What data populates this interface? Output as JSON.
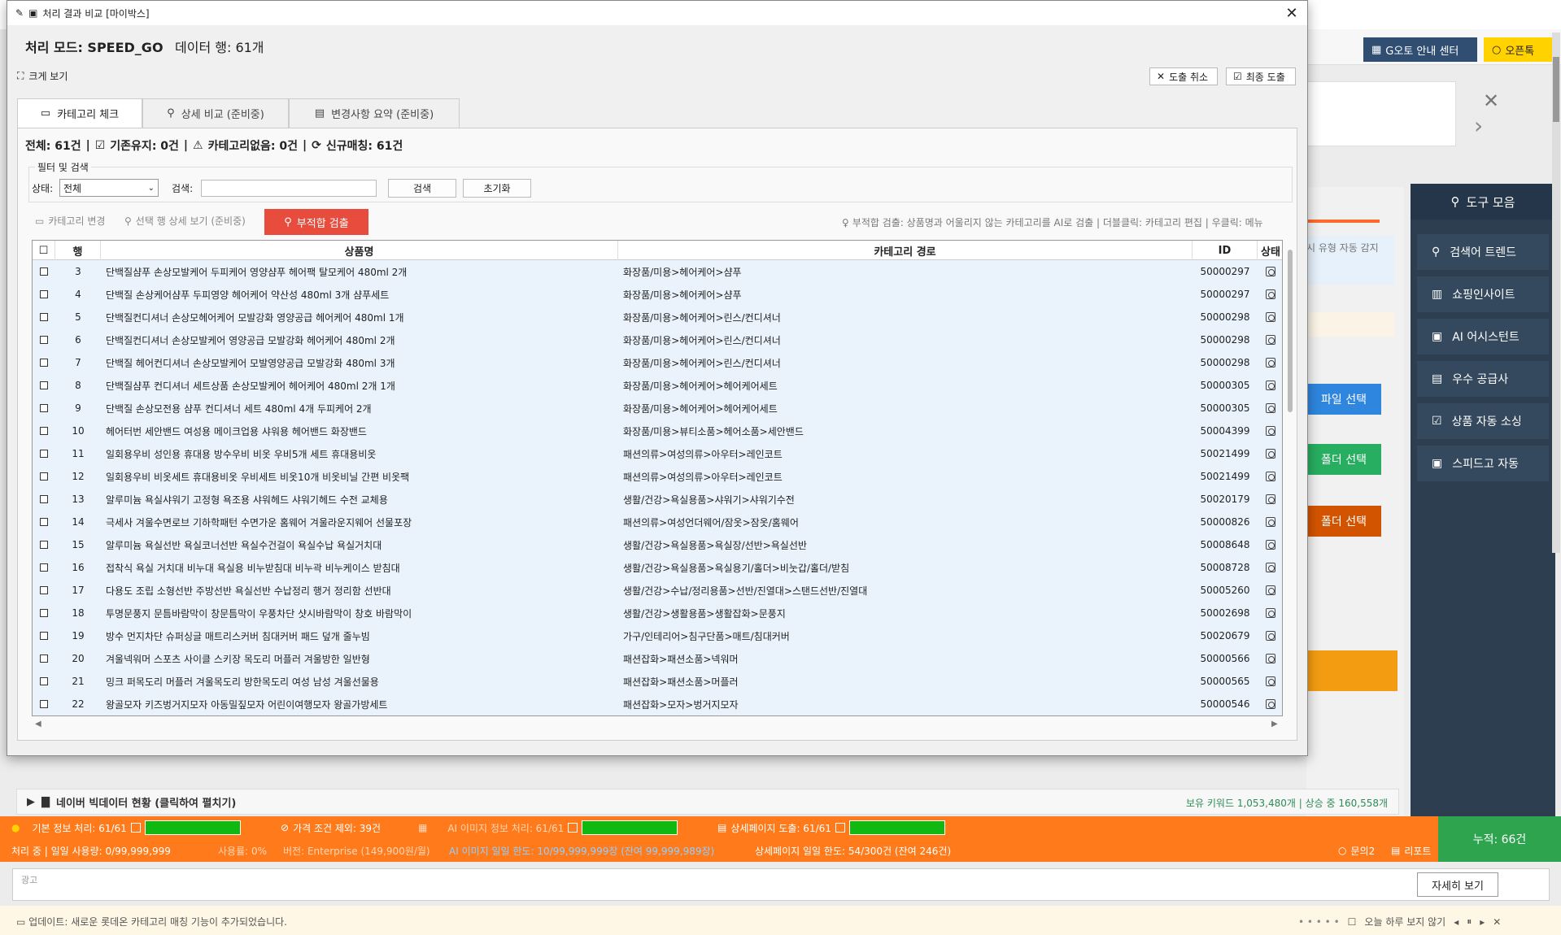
{
  "dialog": {
    "title": "처리 결과 비교 [마이박스]",
    "mode_label": "처리 모드: SPEED_GO",
    "rows_label": "데이터 행: 61개",
    "big_view": "크게 보기",
    "cancel_label": "도출 취소",
    "final_label": "최종 도출",
    "tabs": [
      "카테고리 체크",
      "상세 비교 (준비중)",
      "변경사항 요약 (준비중)"
    ],
    "summary": {
      "total": "전체: 61건",
      "kept": "기존유지: 0건",
      "no_category": "카테고리없음: 0건",
      "new_match": "신규매칭: 61건"
    },
    "filter": {
      "title": "필터 및 검색",
      "status_label": "상태:",
      "status_value": "전체",
      "search_label": "검색:",
      "search_value": "",
      "search_button": "검색",
      "reset_button": "초기화"
    },
    "actions": {
      "change_category": "카테고리 변경",
      "detail_view": "선택 행 상세 보기 (준비중)",
      "inappropriate": "부적합 검출",
      "hint": "부적합 검출: 상품명과 어울리지 않는 카테고리를 AI로 검출 | 더블클릭: 카테고리 편집 | 우클릭: 메뉴"
    },
    "table": {
      "headers": [
        "☐",
        "행",
        "상품명",
        "카테고리 경로",
        "ID",
        "상태"
      ],
      "rows": [
        [
          "3",
          "단백질샴푸 손상모발케어 두피케어 영양샴푸 헤어팩 탈모케어 480ml 2개",
          "화장품/미용>헤어케어>샴푸",
          "50000297"
        ],
        [
          "4",
          "단백질 손상케어샴푸 두피영양 헤어케어 약산성 480ml 3개 샴푸세트",
          "화장품/미용>헤어케어>샴푸",
          "50000297"
        ],
        [
          "5",
          "단백질컨디셔너 손상모헤어케어 모발강화 영양공급 헤어케어 480ml 1개",
          "화장품/미용>헤어케어>린스/컨디셔너",
          "50000298"
        ],
        [
          "6",
          "단백질컨디셔너 손상모발케어 영양공급 모발강화 헤어케어 480ml 2개",
          "화장품/미용>헤어케어>린스/컨디셔너",
          "50000298"
        ],
        [
          "7",
          "단백질 헤어컨디셔너 손상모발케어 모발영양공급 모발강화 480ml 3개",
          "화장품/미용>헤어케어>린스/컨디셔너",
          "50000298"
        ],
        [
          "8",
          "단백질샴푸 컨디셔너 세트상품 손상모발케어 헤어케어 480ml 2개 1개",
          "화장품/미용>헤어케어>헤어케어세트",
          "50000305"
        ],
        [
          "9",
          "단백질 손상모전용 샴푸 컨디셔너 세트 480ml 4개 두피케어 2개",
          "화장품/미용>헤어케어>헤어케어세트",
          "50000305"
        ],
        [
          "10",
          "헤어터번 세안밴드 여성용 메이크업용 샤워용 헤어밴드 화장밴드",
          "화장품/미용>뷰티소품>헤어소품>세안밴드",
          "50004399"
        ],
        [
          "11",
          "일회용우비 성인용 휴대용 방수우비 비옷 우비5개 세트 휴대용비옷",
          "패션의류>여성의류>아우터>레인코트",
          "50021499"
        ],
        [
          "12",
          "일회용우비 비옷세트 휴대용비옷 우비세트 비옷10개 비옷비닐 간편 비옷팩",
          "패션의류>여성의류>아우터>레인코트",
          "50021499"
        ],
        [
          "13",
          "알루미늄 욕실샤워기 고정형 욕조용 샤워헤드 샤워기헤드 수전 교체용",
          "생활/건강>욕실용품>샤워기>샤워기수전",
          "50020179"
        ],
        [
          "14",
          "극세사 겨울수면로브 기하학패턴 수면가운 홈웨어 겨울라운지웨어 선물포장",
          "패션의류>여성언더웨어/잠옷>잠옷/홈웨어",
          "50000826"
        ],
        [
          "15",
          "알루미늄 욕실선반 욕실코너선반 욕실수건걸이 욕실수납 욕실거치대",
          "생활/건강>욕실용품>욕실장/선반>욕실선반",
          "50008648"
        ],
        [
          "16",
          "접착식 욕실 거치대 비누대 욕실용 비누받침대 비누곽 비누케이스 받침대",
          "생활/건강>욕실용품>욕실용기/홀더>비눗갑/홀더/받침",
          "50008728"
        ],
        [
          "17",
          "다용도 조립 소형선반 주방선반 욕실선반 수납정리 행거 정리함 선반대",
          "생활/건강>수납/정리용품>선반/진열대>스탠드선반/진열대",
          "50005260"
        ],
        [
          "18",
          "투명문풍지 문틈바람막이 창문틈막이 우풍차단 샷시바람막이 창호 바람막이",
          "생활/건강>생활용품>생활잡화>문풍지",
          "50002698"
        ],
        [
          "19",
          "방수 먼지차단 슈퍼싱글 매트리스커버 침대커버 패드 덮개 줄누빔",
          "가구/인테리어>침구단품>매트/침대커버",
          "50020679"
        ],
        [
          "20",
          "겨울넥워머 스포츠 사이클 스키장 목도리 머플러 겨울방한 일반형",
          "패션잡화>패션소품>넥워머",
          "50000566"
        ],
        [
          "21",
          "밍크 퍼목도리 머플러 겨울목도리 방한목도리 여성 남성 겨울선물용",
          "패션잡화>패션소품>머플러",
          "50000565"
        ],
        [
          "22",
          "왕골모자 키즈벙거지모자 아동밀짚모자 어린이여행모자 왕골가방세트",
          "패션잡화>모자>벙거지모자",
          "50000546"
        ]
      ]
    }
  },
  "background": {
    "guide_btn": "G오토 안내 센터",
    "open_btn": "오픈톡",
    "toolbox_title": "도구 모음",
    "tools": [
      "검색어 트렌드",
      "쇼핑인사이트",
      "AI 어시스턴트",
      "우수 공급사",
      "상품 자동 소싱",
      "스피드고 자동"
    ],
    "file_select": "파일 선택",
    "folder_select_1": "폴더 선택",
    "folder_select_2": "폴더 선택",
    "auto_detect": "시 유형 자동 감지",
    "bigdata_label": "네이버 빅데이터 현황 (클릭하여 펼치기)",
    "bigdata_stats": "보유 키워드 1,053,480개 | 상승 중 160,558개",
    "status": {
      "basic": "기본 정보 처리: 61/61",
      "basic_progress": 1.0,
      "price_excl": "가격 조건 제외: 39건",
      "ai_image": "AI 이미지 정보 처리: 61/61",
      "ai_image_progress": 1.0,
      "detail_page": "상세페이지 도출: 61/61",
      "detail_progress": 1.0,
      "processing": "처리 중 | 일일 사용량: 0/99,999,999",
      "usage": "사용률: 0%",
      "version": "버전: Enterprise (149,900원/월)",
      "ai_limit": "AI 이미지 일일 한도: 10/99,999,999장 (잔여 99,999,989장)",
      "detail_limit": "상세페이지 일일 한도: 54/300건 (잔여 246건)",
      "inquiry": "문의2",
      "report": "리포트",
      "accum": "누적: 66건"
    },
    "ad_label": "광고",
    "ad_button": "자세히 보기",
    "update_text": "업데이트: 새로운 롯데온 카테고리 매칭 기능이 추가되었습니다.",
    "dont_show": "오늘 하루 보지 않기"
  }
}
